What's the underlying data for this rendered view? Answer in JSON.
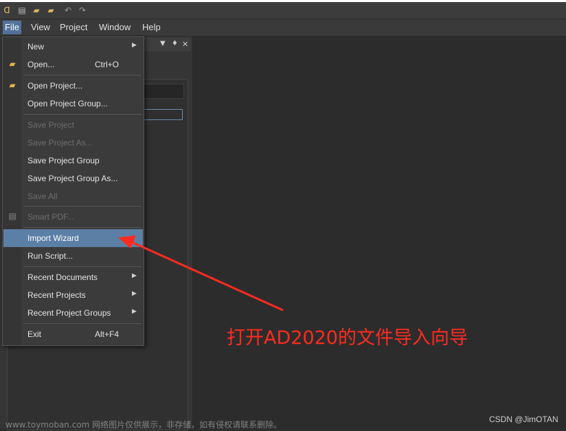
{
  "menubar": [
    "File",
    "View",
    "Project",
    "Window",
    "Help"
  ],
  "file_menu": {
    "items": [
      {
        "label": "New",
        "submenu": true
      },
      {
        "label": "Open...",
        "shortcut": "Ctrl+O",
        "icon": "folder-open-icon"
      },
      {
        "label": "Open Project...",
        "icon": "project-open-icon"
      },
      {
        "label": "Open Project Group..."
      },
      {
        "label": "Save Project",
        "disabled": true
      },
      {
        "label": "Save Project As...",
        "disabled": true
      },
      {
        "label": "Save Project Group"
      },
      {
        "label": "Save Project Group As..."
      },
      {
        "label": "Save All",
        "disabled": true
      },
      {
        "label": "Smart PDF...",
        "disabled": true,
        "icon": "pdf-icon"
      },
      {
        "label": "Import Wizard",
        "highlighted": true
      },
      {
        "label": "Run Script..."
      },
      {
        "label": "Recent Documents",
        "submenu": true
      },
      {
        "label": "Recent Projects",
        "submenu": true
      },
      {
        "label": "Recent Project Groups",
        "submenu": true
      },
      {
        "label": "Exit",
        "shortcut": "Alt+F4"
      }
    ]
  },
  "panel": {
    "pin_icon": "pin-icon",
    "close_icon": "close-icon",
    "dropdown_icon": "chevron-down-icon"
  },
  "annotation": {
    "text": "打开AD2020的文件导入向导",
    "color": "#ff2b1f"
  },
  "watermark": "www.toymoban.com 网络图片仅供展示，非存储，如有侵权请联系删除。",
  "credit": "CSDN @JimOTAN",
  "colors": {
    "highlight": "#5c7fa6",
    "menubar_active": "#50739b",
    "background": "#2d2d2d"
  }
}
